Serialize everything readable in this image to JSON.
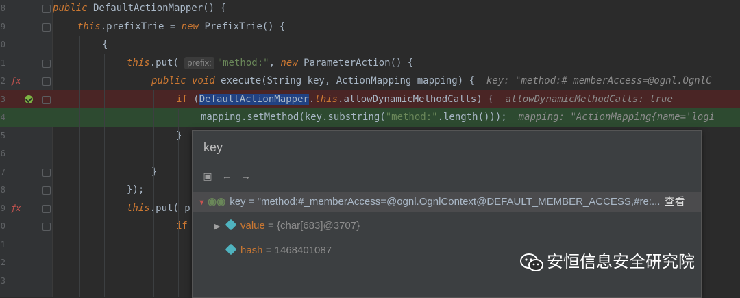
{
  "gutter": {
    "line_numbers": [
      "8",
      "9",
      "0",
      "1",
      "2",
      "3",
      "4",
      "5",
      "6",
      "7",
      "8",
      "9",
      "0",
      "1",
      "2",
      "3"
    ]
  },
  "code_lines": [
    {
      "indent": 0,
      "parts": [
        [
          "kw",
          "public"
        ],
        [
          "plain",
          " DefaultActionMapper() {"
        ]
      ]
    },
    {
      "indent": 1,
      "parts": [
        [
          "kw",
          "this"
        ],
        [
          "plain",
          ".prefixTrie = "
        ],
        [
          "kw",
          "new"
        ],
        [
          "plain",
          " PrefixTrie() {"
        ]
      ]
    },
    {
      "indent": 2,
      "parts": [
        [
          "plain",
          "{"
        ]
      ]
    },
    {
      "indent": 3,
      "parts": [
        [
          "kw",
          "this"
        ],
        [
          "plain",
          ".put( "
        ],
        [
          "hint",
          "prefix:"
        ],
        [
          "str",
          "\"method:\""
        ],
        [
          "plain",
          ", "
        ],
        [
          "kw",
          "new"
        ],
        [
          "plain",
          " ParameterAction() {"
        ]
      ]
    },
    {
      "indent": 4,
      "parts": [
        [
          "kw",
          "public void"
        ],
        [
          "plain",
          " execute(String key, ActionMapping mapping) {  "
        ],
        [
          "inline",
          "key: \"method:#_memberAccess=@ognl.OgnlC"
        ]
      ]
    },
    {
      "indent": 5,
      "parts": [
        [
          "kw2",
          "if"
        ],
        [
          "plain",
          " ("
        ],
        [
          "sel",
          "DefaultActionMapper"
        ],
        [
          "plain",
          "."
        ],
        [
          "kw",
          "this"
        ],
        [
          "plain",
          ".allowDynamicMethodCalls) {  "
        ],
        [
          "inline",
          "allowDynamicMethodCalls: true"
        ]
      ]
    },
    {
      "indent": 6,
      "parts": [
        [
          "plain",
          "mapping.setMethod(key.substring("
        ],
        [
          "str",
          "\"method:\""
        ],
        [
          "plain",
          ".length()));  "
        ],
        [
          "inline",
          "mapping: \"ActionMapping{name='logi"
        ]
      ]
    },
    {
      "indent": 5,
      "parts": [
        [
          "plain",
          "}"
        ]
      ]
    },
    {
      "indent": 4,
      "parts": [
        [
          "plain",
          ""
        ]
      ]
    },
    {
      "indent": 4,
      "parts": [
        [
          "plain",
          "}"
        ]
      ]
    },
    {
      "indent": 3,
      "parts": [
        [
          "plain",
          "});"
        ]
      ]
    },
    {
      "indent": 3,
      "parts": [
        [
          "kw",
          "this"
        ],
        [
          "plain",
          ".put( p"
        ]
      ]
    },
    {
      "indent": 5,
      "parts": [
        [
          "kw2",
          "if"
        ]
      ]
    },
    {
      "indent": 0,
      "parts": [
        [
          "plain",
          ""
        ]
      ]
    },
    {
      "indent": 0,
      "parts": [
        [
          "plain",
          ""
        ]
      ]
    },
    {
      "indent": 0,
      "parts": [
        [
          "plain",
          ""
        ]
      ]
    }
  ],
  "popup": {
    "title": "key",
    "toolbar": [
      "folder-icon",
      "back-arrow-icon",
      "forward-arrow-icon"
    ],
    "rows": [
      {
        "name": "key",
        "value": "\"method:#_memberAccess=@ognl.OgnlContext@DEFAULT_MEMBER_ACCESS,#re:...",
        "link": "查看"
      },
      {
        "name": "value",
        "value": "{char[683]@3707}"
      },
      {
        "name": "hash",
        "value": "1468401087"
      }
    ]
  },
  "watermark": {
    "text": "安恒信息安全研究院"
  }
}
